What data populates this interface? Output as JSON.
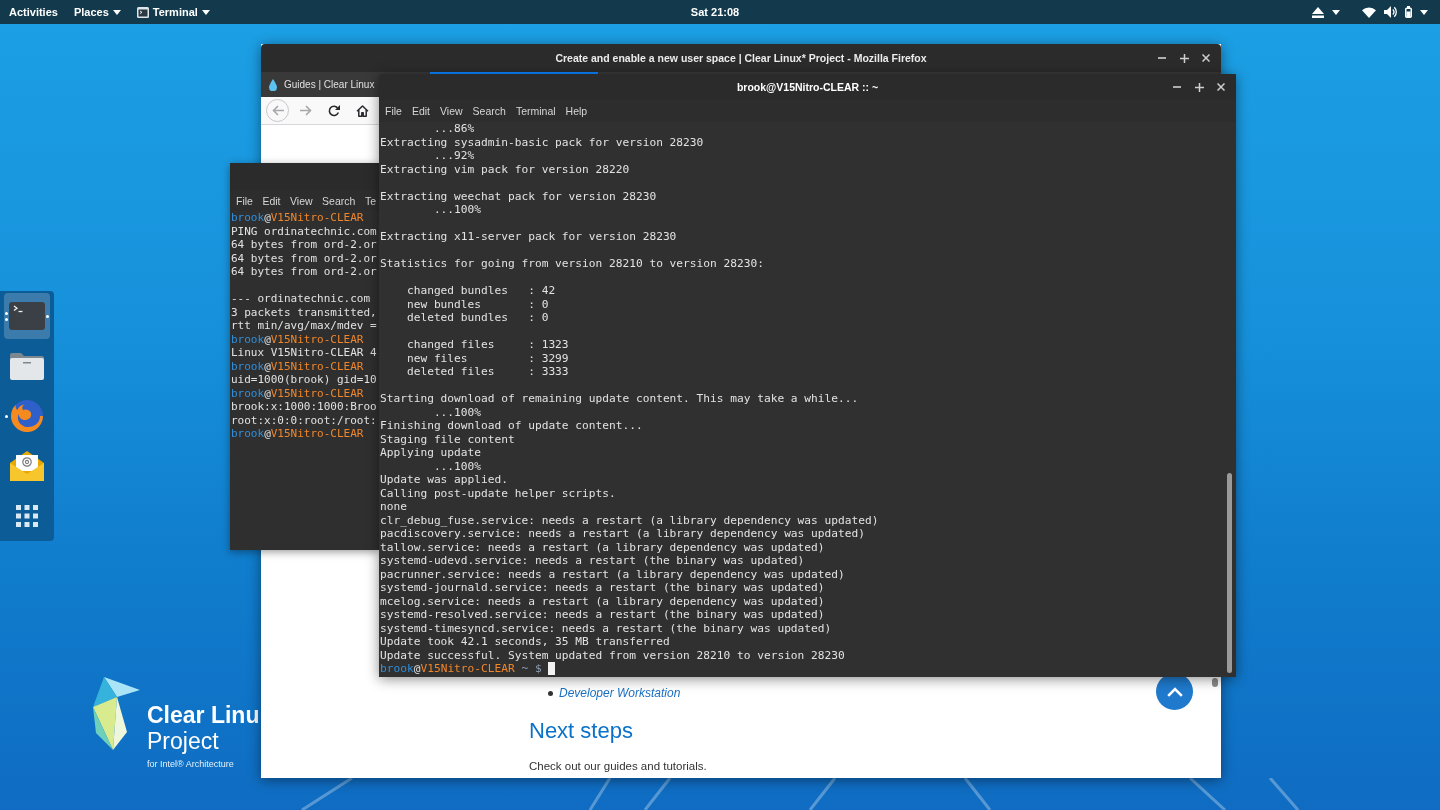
{
  "top_bar": {
    "activities": "Activities",
    "menus": [
      {
        "kind": "places",
        "label": "Places"
      },
      {
        "kind": "app",
        "label": "Terminal"
      }
    ],
    "clock": "Sat 21:08"
  },
  "dock": {
    "items": [
      {
        "kind": "terminal",
        "selected": true,
        "running": true,
        "multiple_windows": true
      },
      {
        "kind": "files",
        "selected": false,
        "running": false,
        "multiple_windows": false
      },
      {
        "kind": "browser",
        "selected": false,
        "running": true,
        "multiple_windows": false
      },
      {
        "kind": "mail",
        "selected": false,
        "running": false,
        "multiple_windows": false
      },
      {
        "kind": "app-grid",
        "selected": false,
        "running": false,
        "multiple_windows": false
      }
    ]
  },
  "wallpaper_logo": {
    "title": "Clear Linu",
    "subtitle": "Project",
    "caption": "for Intel® Architecture"
  },
  "browser_window": {
    "title": "Create and enable a new user space | Clear Linux* Project - Mozilla Firefox",
    "tabs": [
      {
        "label": "Guides | Clear Linux",
        "selected": false
      },
      {
        "selected": true
      }
    ],
    "nav_buttons": [
      {
        "kind": "back",
        "disabled": true
      },
      {
        "kind": "forward",
        "disabled": true
      },
      {
        "kind": "reload",
        "disabled": false
      },
      {
        "kind": "home",
        "disabled": false
      }
    ],
    "page": {
      "list_items": [
        "Developer Workstation"
      ],
      "heading": "Next steps",
      "paragraph": "Check out our guides and tutorials."
    }
  },
  "background_terminal": {
    "menu": [
      "File",
      "Edit",
      "View",
      "Search",
      "Te"
    ],
    "blocks": [
      [
        {
          "kind": "prompt",
          "user": "brook",
          "at": "@",
          "host": "V15Nitro-CLEAR"
        },
        {
          "kind": "output",
          "text": "PING ordinatechnic.com"
        },
        {
          "kind": "output",
          "text": "64 bytes from ord-2.or"
        },
        {
          "kind": "output",
          "text": "64 bytes from ord-2.or"
        },
        {
          "kind": "output",
          "text": "64 bytes from ord-2.or"
        }
      ],
      [
        {
          "kind": "output",
          "text": "--- ordinatechnic.com"
        },
        {
          "kind": "output",
          "text": "3 packets transmitted,"
        },
        {
          "kind": "output",
          "text": "rtt min/avg/max/mdev ="
        },
        {
          "kind": "prompt",
          "user": "brook",
          "at": "@",
          "host": "V15Nitro-CLEAR"
        },
        {
          "kind": "output",
          "text": "Linux V15Nitro-CLEAR 4"
        },
        {
          "kind": "prompt",
          "user": "brook",
          "at": "@",
          "host": "V15Nitro-CLEAR"
        },
        {
          "kind": "output",
          "text": "uid=1000(brook) gid=10"
        },
        {
          "kind": "prompt",
          "user": "brook",
          "at": "@",
          "host": "V15Nitro-CLEAR"
        },
        {
          "kind": "output",
          "text": "brook:x:1000:1000:Broo"
        },
        {
          "kind": "output",
          "text": "root:x:0:0:root:/root:"
        },
        {
          "kind": "prompt",
          "user": "brook",
          "at": "@",
          "host": "V15Nitro-CLEAR"
        }
      ]
    ]
  },
  "terminal_window": {
    "title": "brook@V15Nitro-CLEAR :: ~",
    "menu": [
      "File",
      "Edit",
      "View",
      "Search",
      "Terminal",
      "Help"
    ],
    "blocks": [
      [
        {
          "kind": "output",
          "text": "        ...86%"
        },
        {
          "kind": "output",
          "text": "Extracting sysadmin-basic pack for version 28230"
        },
        {
          "kind": "output",
          "text": "        ...92%"
        },
        {
          "kind": "output",
          "text": "Extracting vim pack for version 28220"
        }
      ],
      [
        {
          "kind": "output",
          "text": "Extracting weechat pack for version 28230"
        },
        {
          "kind": "output",
          "text": "        ...100%"
        }
      ],
      [
        {
          "kind": "output",
          "text": "Extracting x11-server pack for version 28230"
        }
      ],
      [
        {
          "kind": "output",
          "text": "Statistics for going from version 28210 to version 28230:"
        }
      ],
      [
        {
          "kind": "output",
          "text": "    changed bundles   : 42"
        },
        {
          "kind": "output",
          "text": "    new bundles       : 0"
        },
        {
          "kind": "output",
          "text": "    deleted bundles   : 0"
        }
      ],
      [
        {
          "kind": "output",
          "text": "    changed files     : 1323"
        },
        {
          "kind": "output",
          "text": "    new files         : 3299"
        },
        {
          "kind": "output",
          "text": "    deleted files     : 3333"
        }
      ],
      [
        {
          "kind": "output",
          "text": "Starting download of remaining update content. This may take a while..."
        },
        {
          "kind": "output",
          "text": "        ...100%"
        },
        {
          "kind": "output",
          "text": "Finishing download of update content..."
        },
        {
          "kind": "output",
          "text": "Staging file content"
        },
        {
          "kind": "output",
          "text": "Applying update"
        },
        {
          "kind": "output",
          "text": "        ...100%"
        },
        {
          "kind": "output",
          "text": "Update was applied."
        },
        {
          "kind": "output",
          "text": "Calling post-update helper scripts."
        },
        {
          "kind": "output",
          "text": "none"
        },
        {
          "kind": "output",
          "text": "clr_debug_fuse.service: needs a restart (a library dependency was updated)"
        },
        {
          "kind": "output",
          "text": "pacdiscovery.service: needs a restart (a library dependency was updated)"
        },
        {
          "kind": "output",
          "text": "tallow.service: needs a restart (a library dependency was updated)"
        },
        {
          "kind": "output",
          "text": "systemd-udevd.service: needs a restart (the binary was updated)"
        },
        {
          "kind": "output",
          "text": "pacrunner.service: needs a restart (a library dependency was updated)"
        },
        {
          "kind": "output",
          "text": "systemd-journald.service: needs a restart (the binary was updated)"
        },
        {
          "kind": "output",
          "text": "mcelog.service: needs a restart (a library dependency was updated)"
        },
        {
          "kind": "output",
          "text": "systemd-resolved.service: needs a restart (the binary was updated)"
        },
        {
          "kind": "output",
          "text": "systemd-timesyncd.service: needs a restart (the binary was updated)"
        },
        {
          "kind": "output",
          "text": "Update took 42.1 seconds, 35 MB transferred"
        },
        {
          "kind": "output",
          "text": "Update successful. System updated from version 28210 to version 28230"
        },
        {
          "kind": "prompt",
          "user": "brook",
          "at": "@",
          "host": "V15Nitro-CLEAR",
          "path": "~ $",
          "cursor": true
        }
      ]
    ]
  }
}
